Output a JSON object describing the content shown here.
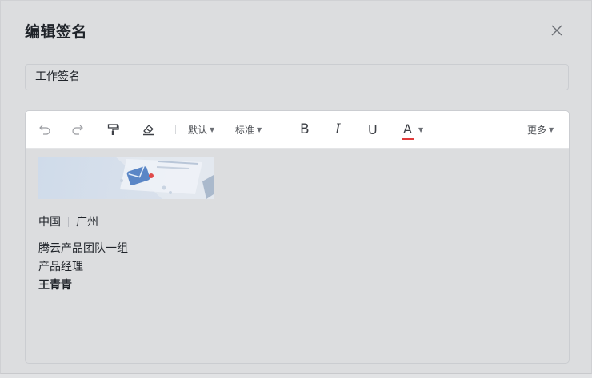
{
  "dialog": {
    "title": "编辑签名",
    "close_icon": "close-icon"
  },
  "signature_name": {
    "value": "工作签名"
  },
  "toolbar": {
    "undo_icon": "undo-icon",
    "redo_icon": "redo-icon",
    "format_painter_icon": "format-painter-icon",
    "clear_format_icon": "eraser-icon",
    "font_family": "默认",
    "font_size": "标准",
    "bold_label": "B",
    "italic_label": "I",
    "underline_label": "U",
    "font_color_label": "A",
    "font_color_accent": "#e03a3a",
    "more_label": "更多"
  },
  "signature": {
    "location_country": "中国",
    "location_city": "广州",
    "team": "腾云产品团队一组",
    "job_title": "产品经理",
    "person_name": "王青青"
  }
}
